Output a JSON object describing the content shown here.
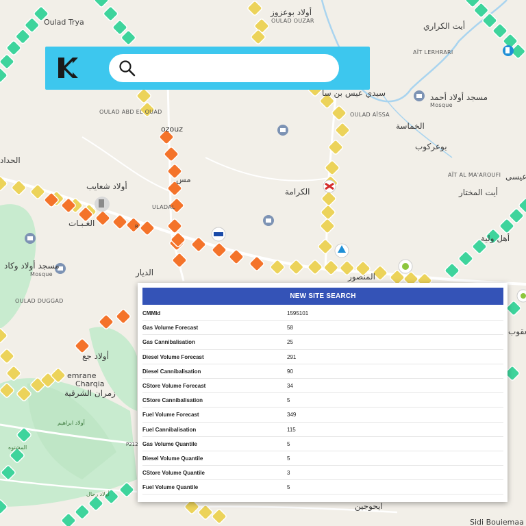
{
  "map": {
    "labels_latin": {
      "oulad_trya": "Oulad Trya",
      "oulad_ouzar": "OULAD OUZAR",
      "ait_lerhrari": "AÏT LERHRARI",
      "mosque_1": "Mosque",
      "mosque_2": "Mosque",
      "oulad_abd_el_ouad": "OULAD ABD EL OUAD",
      "ozouz": "ozouz",
      "oulad_aissa": "OULAD AÏSSA",
      "ait_al_maaroufi": "AÏT AL MA'AROUFI",
      "oulad_duggad": "OULAD DUGGAD",
      "emrane": "emrane",
      "charqia": "Charqia",
      "uladal": "ULADAL",
      "p212": "P212",
      "r": "R",
      "sidi_bouiemaa": "Sidi Bouiemaa"
    },
    "labels_arabic": {
      "oulad_bouazza": "أولاد بوعزوز",
      "ait_lkrari": "أيت الكراري",
      "masjid_oulad_ahmed": "مسجد أولاد أحمد",
      "sidi_ait_bensaid": "سيدي عيس بن سا",
      "lkhamassa": "الخماسة",
      "bougrkoub": "بوعركوب",
      "lhaddad": "الحداد",
      "oulad_chouaib": "أولاد شعايب",
      "lghaba": "الغـبـات",
      "lkarama": "الكرامة",
      "ait_lmokhtar": "أيت المختار",
      "ahl_oubia": "أهل ولية",
      "masjid_oulad_wakad": "مسجد أولاد وكاد",
      "ddiar": "الديار",
      "lmansour": "المنصور",
      "oulad_jaa": "أولاد جع",
      "zamran_charqia": "زمران الشرقية",
      "aissa": "عيسى",
      "yaakoub": "يعقوب",
      "oulad_brahim": "أولاد ابراهيم",
      "lmachtoua": "المشتوه",
      "oulad_rahal": "أولاد رحال",
      "ait_houjjine": "ايحوجين",
      "mus": "مس"
    },
    "colors": {
      "green": "#3ed49c",
      "yellow": "#ecd35a",
      "orange": "#f4732a",
      "park": "#c8ebcf",
      "river": "#a9d4ef",
      "road": "#ffffff"
    }
  },
  "header": {
    "logo": "k-logo-icon",
    "search_placeholder": "",
    "search_value": ""
  },
  "panel": {
    "title": "NEW SITE SEARCH",
    "rows": [
      {
        "label": "CMMId",
        "value": "1595101"
      },
      {
        "label": "Gas Volume Forecast",
        "value": "58"
      },
      {
        "label": "Gas Cannibalisation",
        "value": "25"
      },
      {
        "label": "Diesel Volume Forecast",
        "value": "291"
      },
      {
        "label": "Diesel Cannibalisation",
        "value": "90"
      },
      {
        "label": "CStore Volume Forecast",
        "value": "34"
      },
      {
        "label": "CStore Cannibalisation",
        "value": "5"
      },
      {
        "label": "Fuel Volume Forecast",
        "value": "349"
      },
      {
        "label": "Fuel Cannibalisation",
        "value": "115"
      },
      {
        "label": "Gas Volume Quantile",
        "value": "5"
      },
      {
        "label": "Diesel Volume Quantile",
        "value": "5"
      },
      {
        "label": "CStore Volume Quantile",
        "value": "3"
      },
      {
        "label": "Fuel Volume Quantile",
        "value": "5"
      }
    ]
  }
}
